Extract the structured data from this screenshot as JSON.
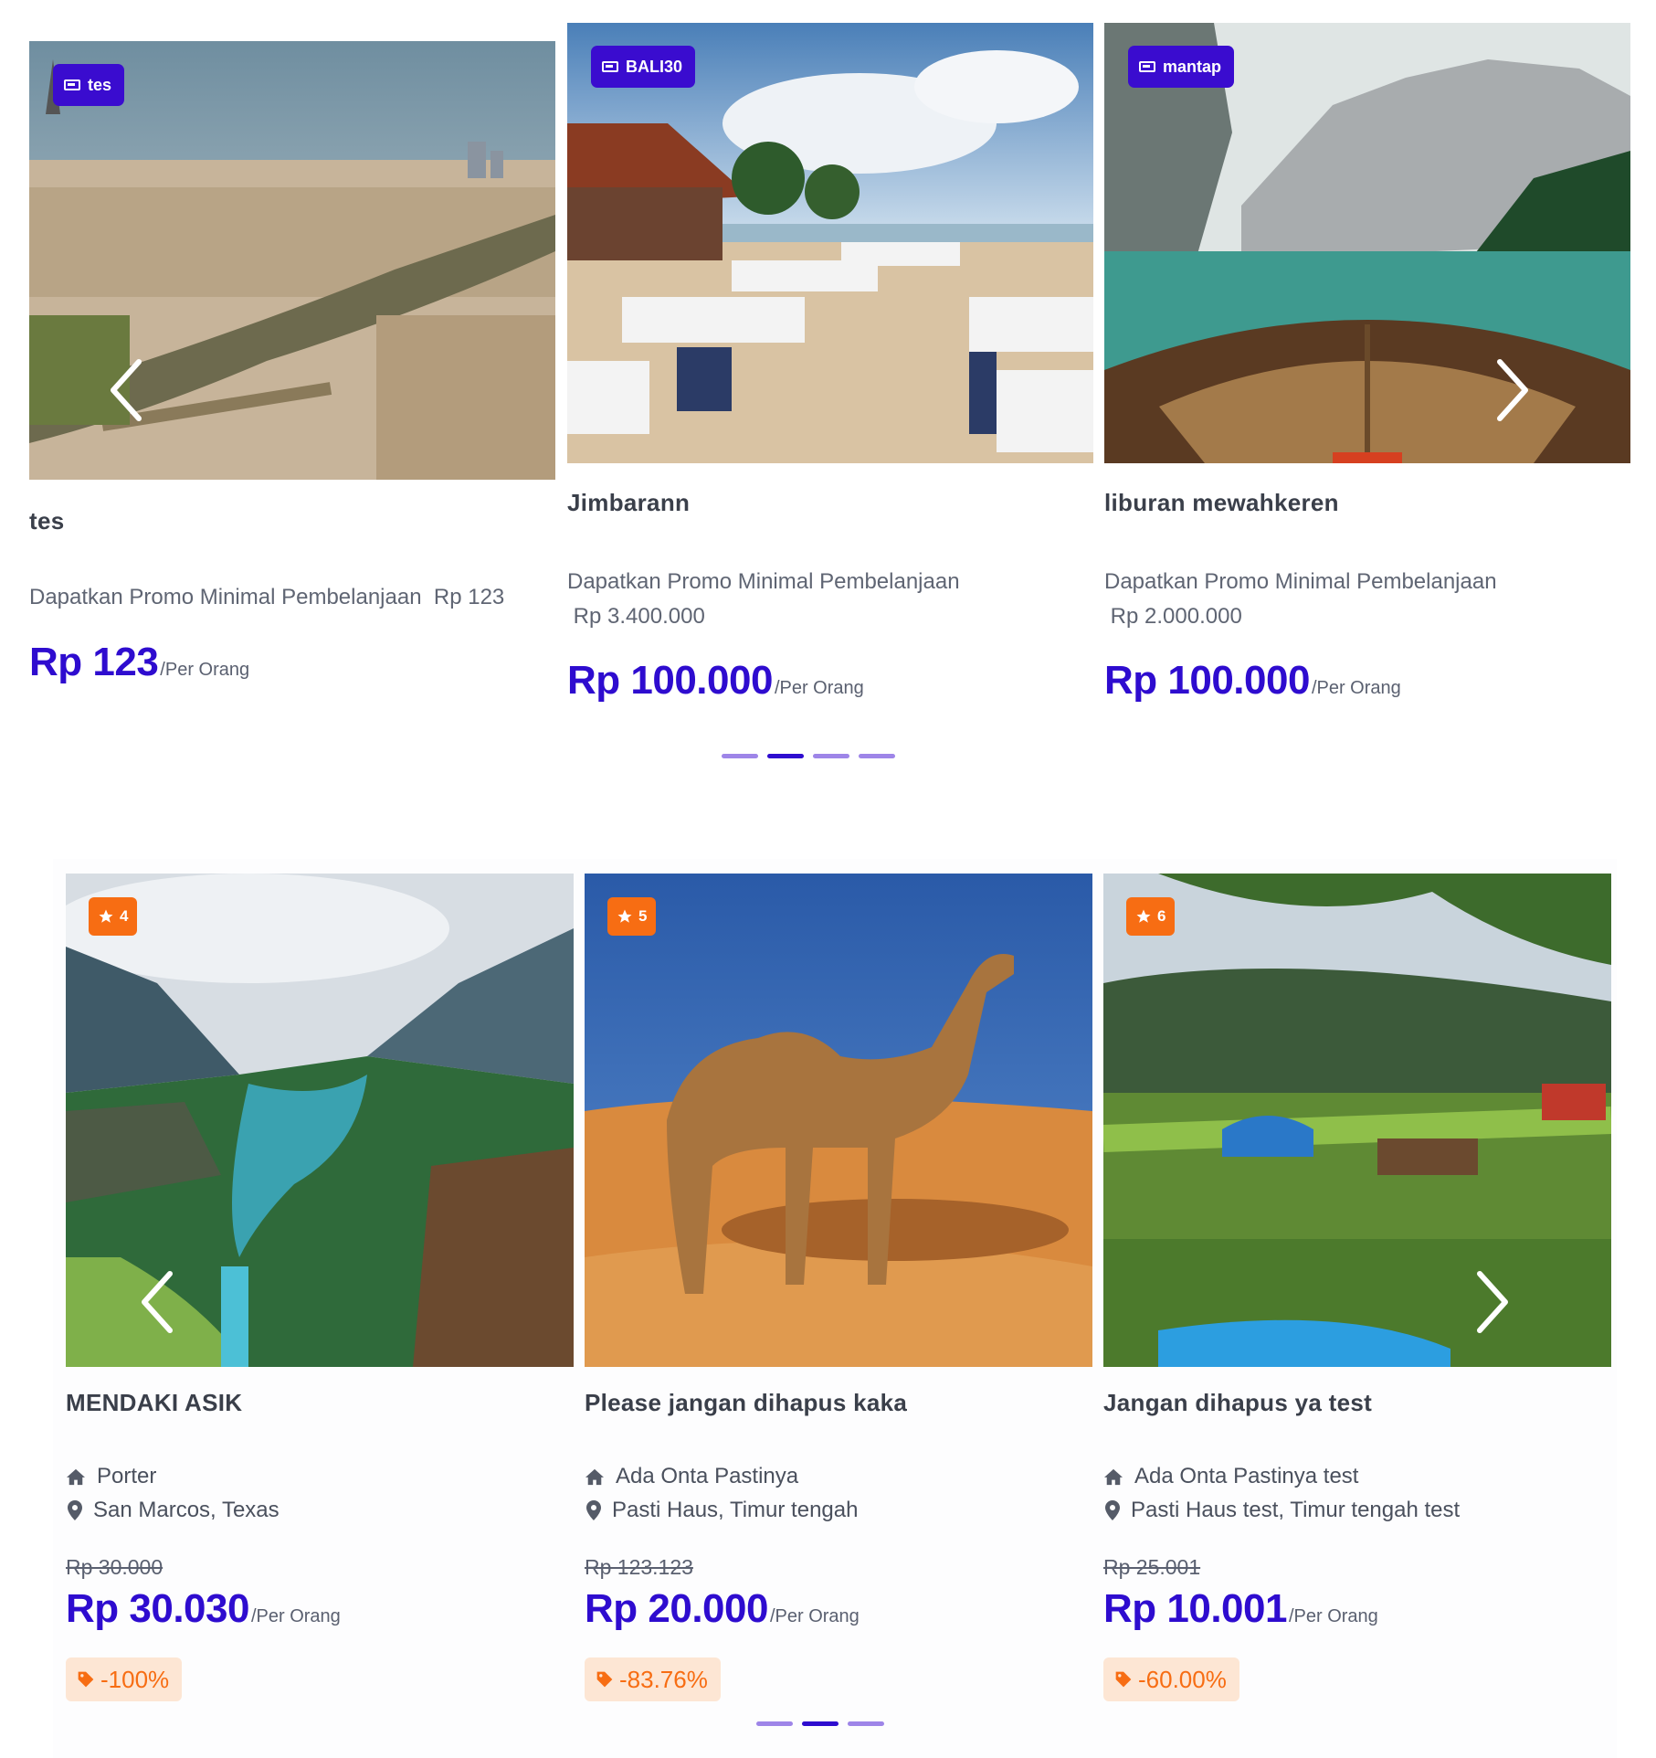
{
  "promo_carousel": {
    "cards": [
      {
        "coupon": "tes",
        "title": "tes",
        "desc_line1": "Dapatkan Promo Minimal Pembelanjaan  Rp 123",
        "desc_line2": "",
        "price": "Rp 123",
        "per": "/Per Orang"
      },
      {
        "coupon": "BALI30",
        "title": "Jimbarann",
        "desc_line1": "Dapatkan Promo Minimal Pembelanjaan",
        "desc_line2": " Rp 3.400.000",
        "price": "Rp 100.000",
        "per": "/Per Orang"
      },
      {
        "coupon": "mantap",
        "title": "liburan mewahkeren",
        "desc_line1": "Dapatkan Promo Minimal Pembelanjaan",
        "desc_line2": " Rp 2.000.000",
        "price": "Rp 100.000",
        "per": "/Per Orang"
      }
    ],
    "dots": 4,
    "active_dot": 1
  },
  "tour_carousel": {
    "cards": [
      {
        "rating": "4",
        "title": "MENDAKI ASIK",
        "facility": "Porter",
        "location": "San Marcos, Texas",
        "old_price": "Rp 30.000",
        "price": "Rp 30.030",
        "per": "/Per Orang",
        "discount": "-100%"
      },
      {
        "rating": "5",
        "title": "Please jangan dihapus kaka",
        "facility": "Ada Onta Pastinya",
        "location": "Pasti Haus, Timur tengah",
        "old_price": "Rp 123.123",
        "price": "Rp 20.000",
        "per": "/Per Orang",
        "discount": "-83.76%"
      },
      {
        "rating": "6",
        "title": "Jangan dihapus ya test",
        "facility": "Ada Onta Pastinya test",
        "location": "Pasti Haus test, Timur tengah test",
        "old_price": "Rp 25.001",
        "price": "Rp 10.001",
        "per": "/Per Orang",
        "discount": "-60.00%"
      }
    ],
    "dots": 3,
    "active_dot": 1
  },
  "icons": {
    "coupon": "ticket-icon",
    "rating": "star-icon",
    "facility": "home-icon",
    "location": "map-pin-icon",
    "discount": "tag-icon",
    "prev": "chevron-left-icon",
    "next": "chevron-right-icon"
  },
  "colors": {
    "accent": "#2e0ccf",
    "coupon_badge": "#3a0ccf",
    "rating_badge": "#f76d13",
    "discount_bg": "#fde6d4",
    "discount_text": "#f76d13",
    "dot_inactive": "#9e85e8"
  }
}
